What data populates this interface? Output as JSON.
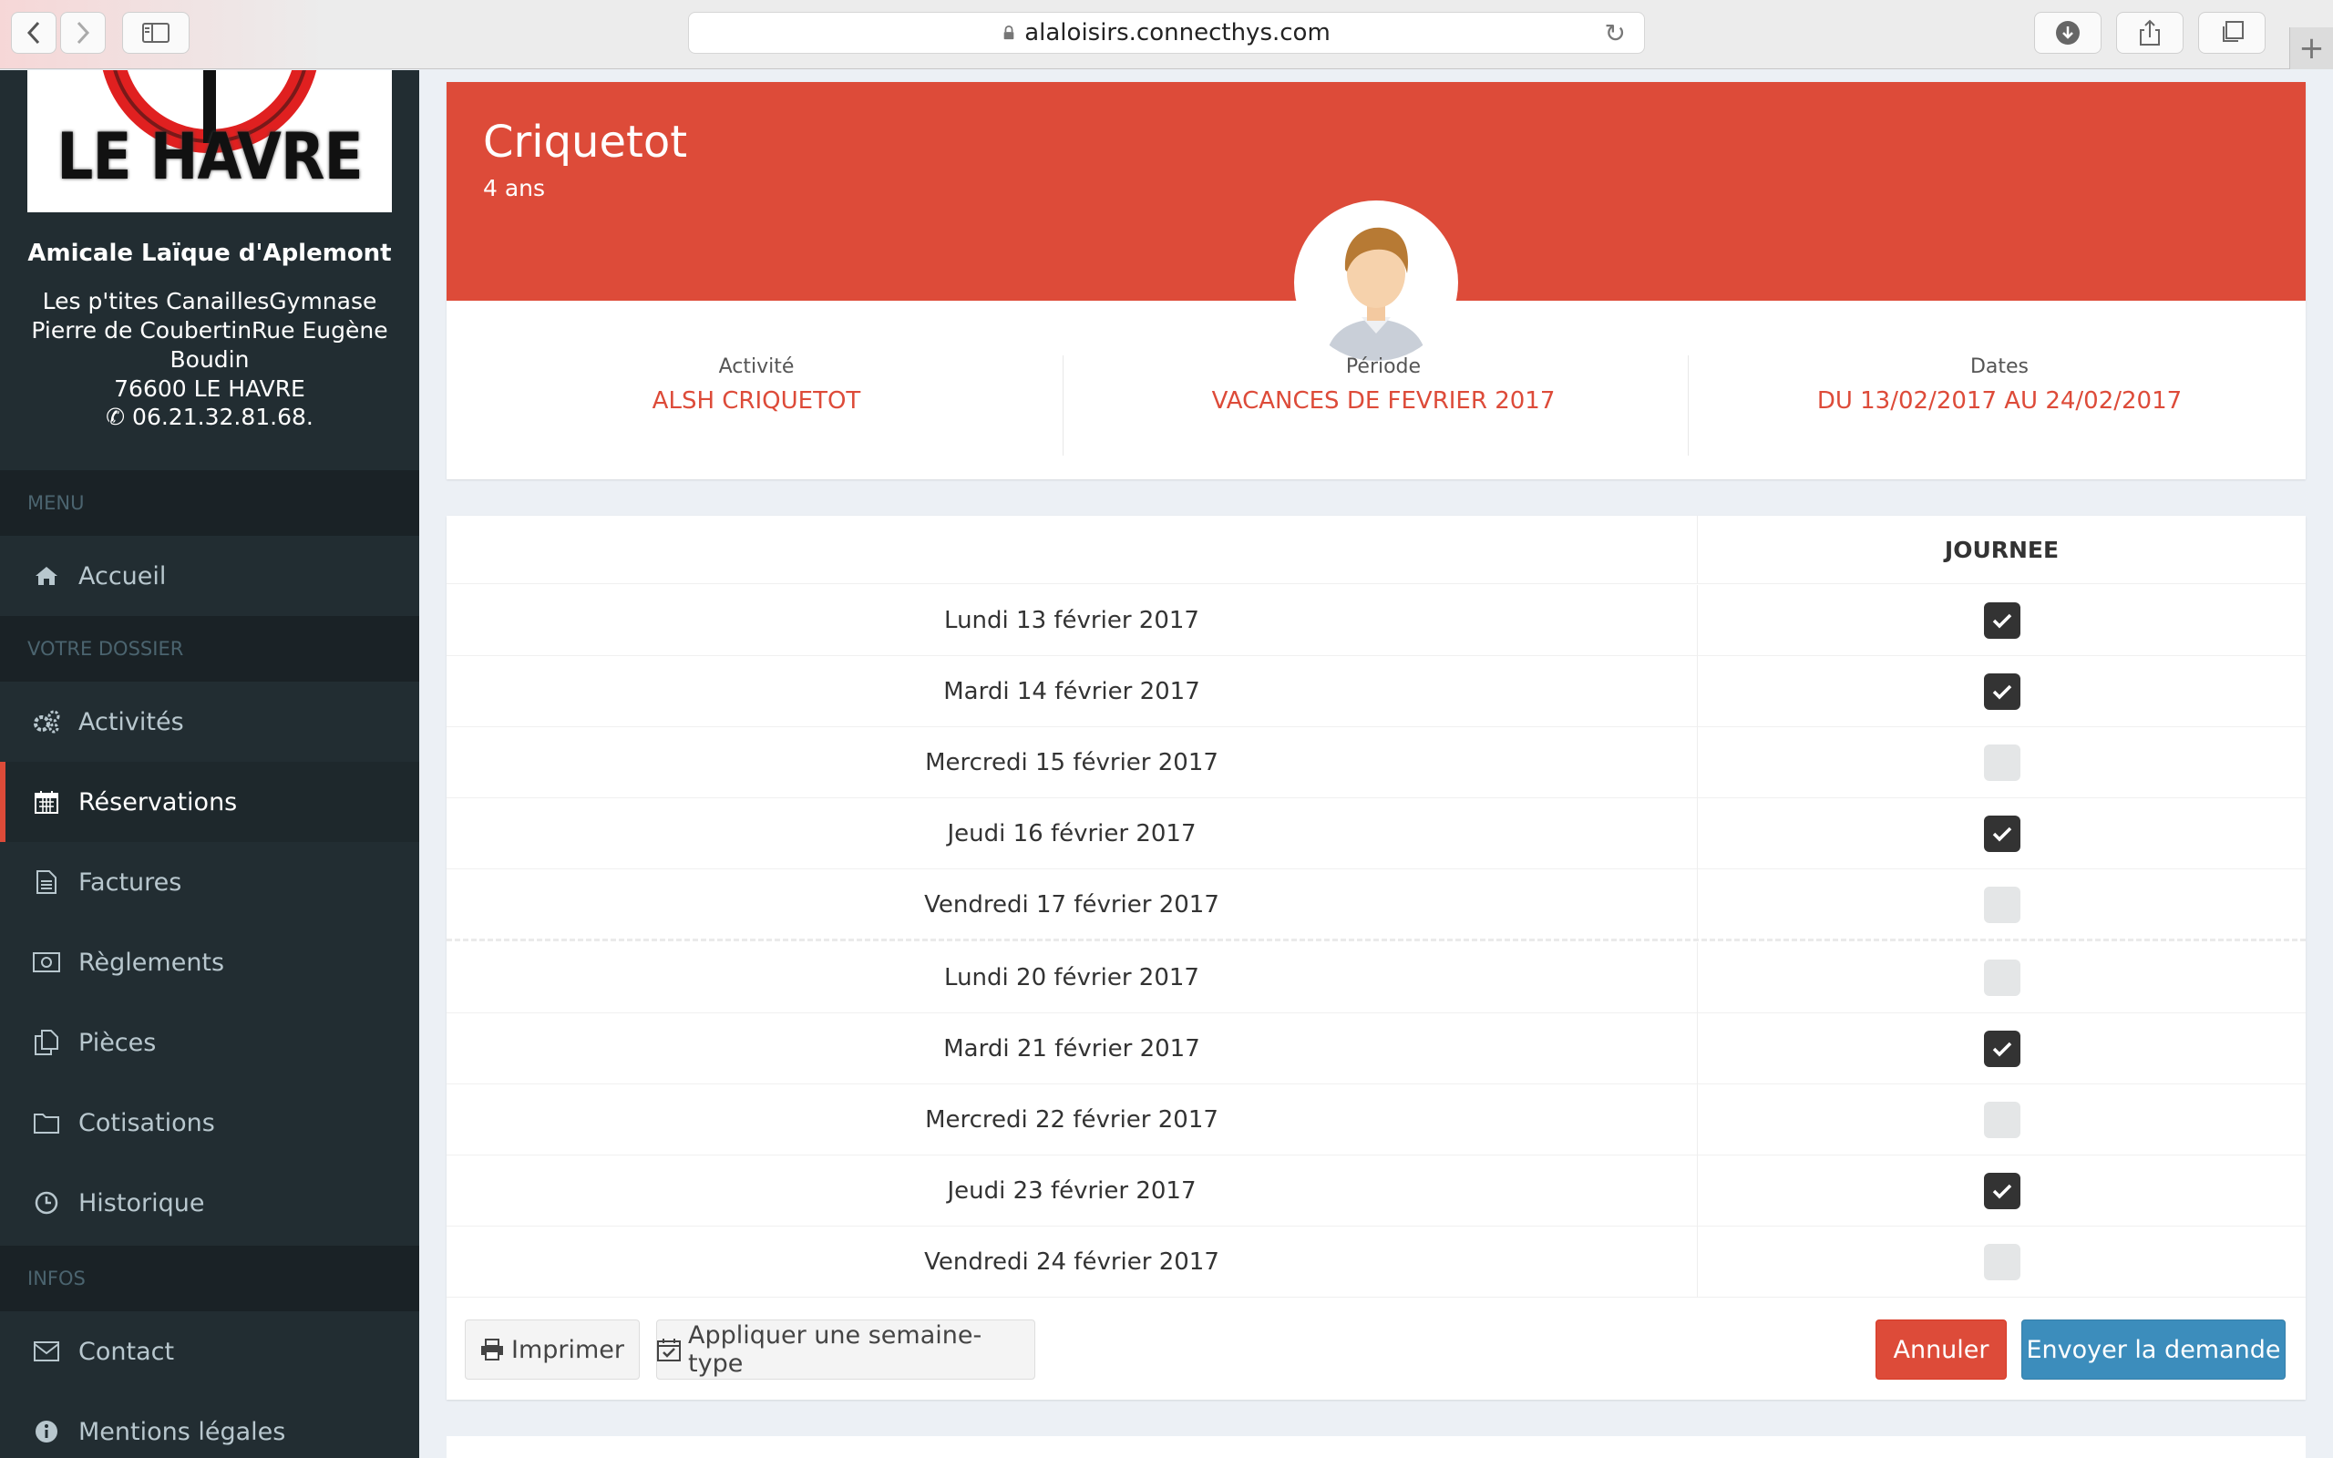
{
  "browser": {
    "url": "alaloisirs.connecthys.com"
  },
  "sidebar": {
    "logo_text": "LE HAVRE",
    "org_name": "Amicale Laïque d'Aplemont",
    "address_lines": [
      "Les p'tites CanaillesGymnase",
      "Pierre de CoubertinRue Eugène",
      "Boudin",
      "76600 LE HAVRE"
    ],
    "phone": "06.21.32.81.68.",
    "sections": {
      "menu": "MENU",
      "dossier": "VOTRE DOSSIER",
      "infos": "INFOS"
    },
    "items": {
      "accueil": "Accueil",
      "activites": "Activités",
      "reservations": "Réservations",
      "factures": "Factures",
      "reglements": "Règlements",
      "pieces": "Pièces",
      "cotisations": "Cotisations",
      "historique": "Historique",
      "contact": "Contact",
      "mentions": "Mentions légales"
    }
  },
  "profile": {
    "name": "Criquetot",
    "age": "4 ans",
    "activite_label": "Activité",
    "activite_value": "ALSH CRIQUETOT",
    "periode_label": "Période",
    "periode_value": "VACANCES DE FEVRIER 2017",
    "dates_label": "Dates",
    "dates_value": "DU 13/02/2017 AU 24/02/2017"
  },
  "table": {
    "column_header": "JOURNEE",
    "rows": [
      {
        "date": "Lundi 13 février 2017",
        "checked": true
      },
      {
        "date": "Mardi 14 février 2017",
        "checked": true
      },
      {
        "date": "Mercredi 15 février 2017",
        "checked": false
      },
      {
        "date": "Jeudi 16 février 2017",
        "checked": true
      },
      {
        "date": "Vendredi 17 février 2017",
        "checked": false
      },
      {
        "date": "Lundi 20 février 2017",
        "checked": false
      },
      {
        "date": "Mardi 21 février 2017",
        "checked": true
      },
      {
        "date": "Mercredi 22 février 2017",
        "checked": false
      },
      {
        "date": "Jeudi 23 février 2017",
        "checked": true
      },
      {
        "date": "Vendredi 24 février 2017",
        "checked": false
      }
    ]
  },
  "actions": {
    "print": "Imprimer",
    "apply_week": "Appliquer une semaine-type",
    "cancel": "Annuler",
    "submit": "Envoyer la demande"
  },
  "colors": {
    "accent_red": "#dd4b39",
    "sidebar_bg": "#222d32",
    "primary_blue": "#3c8dbc"
  }
}
